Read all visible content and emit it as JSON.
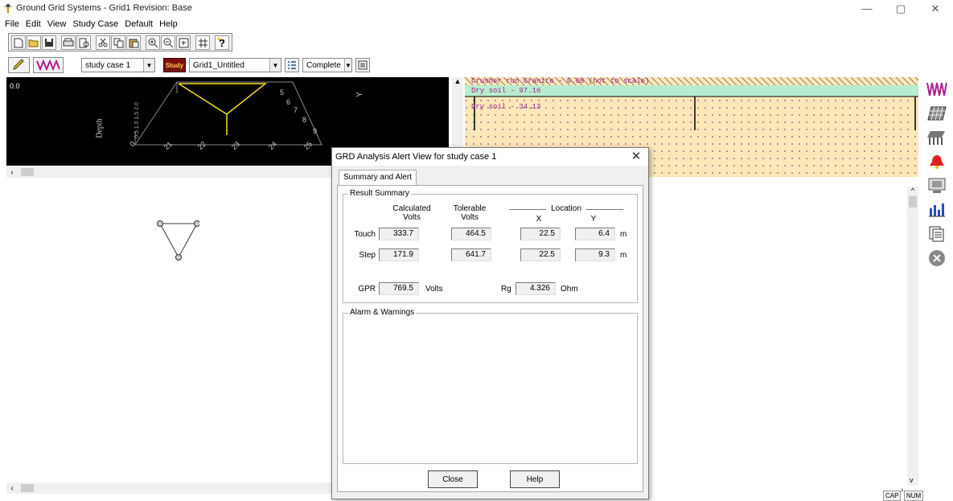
{
  "window": {
    "title": "Ground Grid Systems - Grid1    Revision: Base",
    "minimize": "—",
    "maximize": "▢",
    "close": "✕"
  },
  "menu": [
    "File",
    "Edit",
    "View",
    "Study Case",
    "Default",
    "Help"
  ],
  "toolbar": {
    "study_case": "study case 1",
    "study_button": "Study",
    "grid_name": "Grid1_Untitled",
    "mode": "Complete"
  },
  "grid3d": {
    "origin_label": "0.0",
    "depth_label": "Depth",
    "y_axis_label": "Y",
    "depth_ticks": "0.5 1.0 1.5 2.0",
    "x_ticks": [
      "0",
      "21",
      "22",
      "23",
      "24",
      "25"
    ],
    "y_ticks": [
      "5",
      "6",
      "7",
      "8",
      "9"
    ]
  },
  "soil": {
    "layer1": "Crusher run Granite - 0.08  (not to scale)",
    "layer2": "Dry soil - 97.16",
    "layer3": "Dry soil - 34.13"
  },
  "dialog": {
    "title": "GRD Analysis Alert View for study case 1",
    "close_glyph": "✕",
    "tab": "Summary and Alert",
    "result_group": "Result Summary",
    "col_calculated": "Calculated",
    "col_calculated_unit": "Volts",
    "col_tolerable": "Tolerable",
    "col_tolerable_unit": "Volts",
    "col_location": "Location",
    "col_x": "X",
    "col_y": "Y",
    "touch_label": "Touch",
    "touch_calc": "333.7",
    "touch_tol": "464.5",
    "touch_x": "22.5",
    "touch_y": "6.4",
    "step_label": "Step",
    "step_calc": "171.9",
    "step_tol": "641.7",
    "step_x": "22.5",
    "step_y": "9.3",
    "unit_m": "m",
    "gpr_label": "GPR",
    "gpr_value": "769.5",
    "gpr_unit": "Volts",
    "rg_label": "Rg",
    "rg_value": "4.326",
    "rg_unit": "Ohm",
    "alarm_group": "Alarm & Warnings",
    "close_button": "Close",
    "help_button": "Help"
  },
  "status": {
    "cap": "CAP",
    "num": "NUM"
  }
}
